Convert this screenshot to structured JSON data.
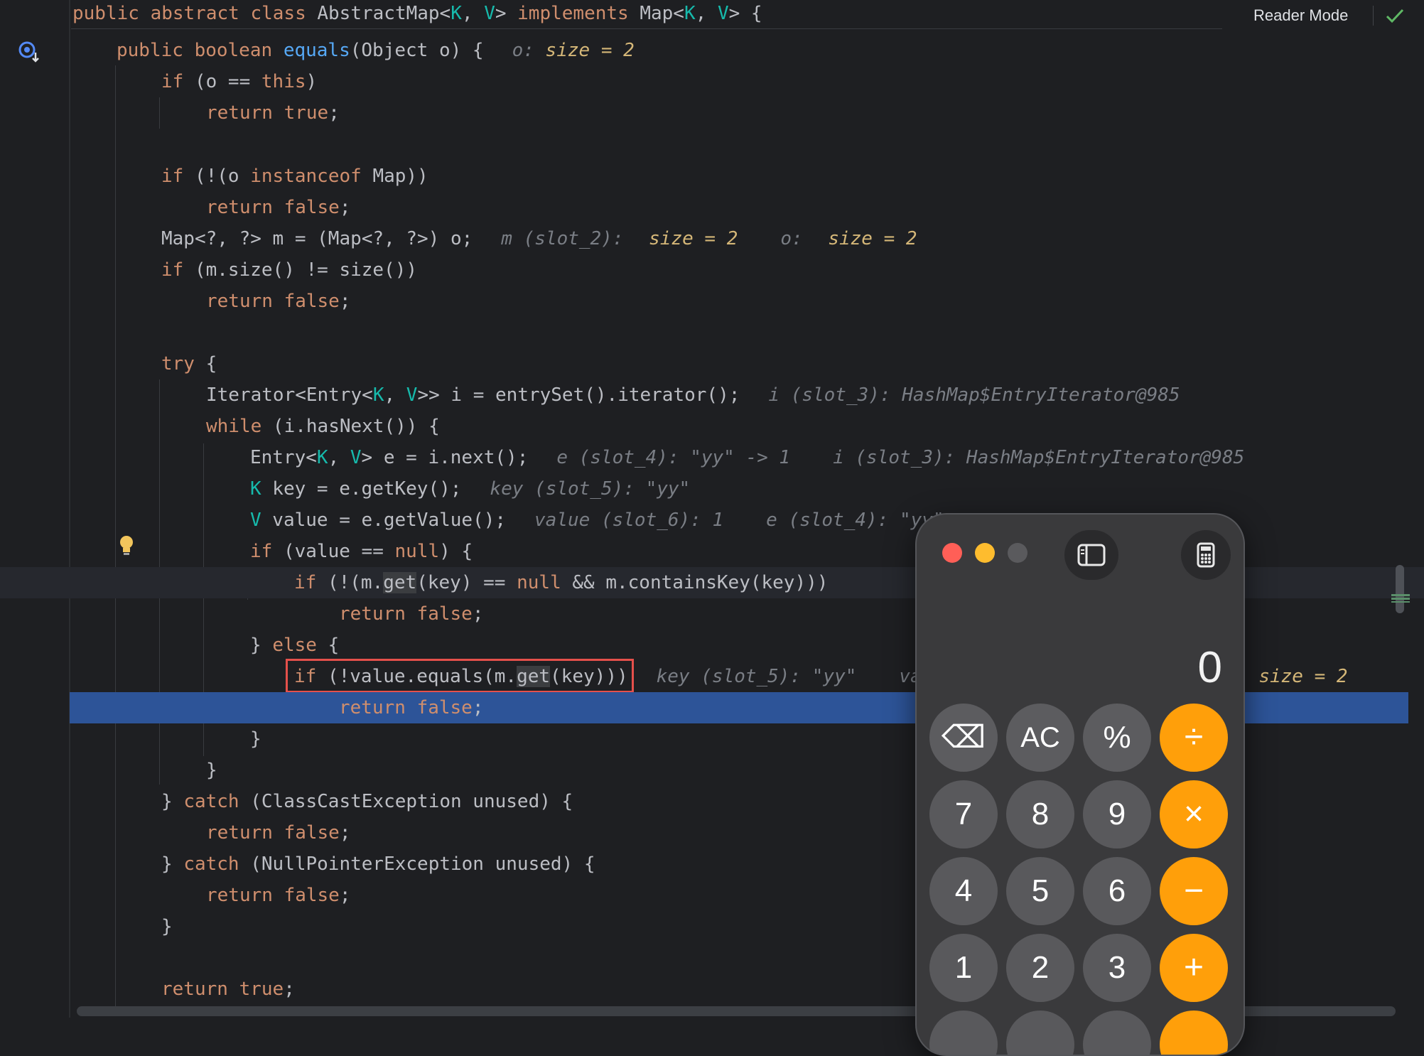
{
  "header": {
    "class_decl": {
      "kw1": "public abstract class ",
      "name": "AbstractMap<",
      "k": "K",
      "comma": ", ",
      "v": "V",
      "close": "> ",
      "kw2": "implements ",
      "iface": "Map<",
      "k2": "K",
      "comma2": ", ",
      "v2": "V",
      "tail": "> {"
    },
    "reader_mode_label": "Reader Mode"
  },
  "code": {
    "l1": {
      "a": "public boolean ",
      "fn": "equals",
      "b": "(Object o) {",
      "h1": "o: ",
      "v1": "size = 2"
    },
    "l2": {
      "kw": "if ",
      "a": "(o == ",
      "kw2": "this",
      "b": ")"
    },
    "l3": {
      "kw": "return true",
      "b": ";"
    },
    "l5": {
      "kw": "if ",
      "a": "(!(o ",
      "kw2": "instanceof ",
      "b": "Map))"
    },
    "l6": {
      "kw": "return false",
      "b": ";"
    },
    "l7": {
      "a": "Map<?, ?> m = (Map<?, ?>) o;",
      "h1": "m (slot_2): ",
      "v1": "size = 2",
      "h2": "o: ",
      "v2": "size = 2"
    },
    "l8": {
      "kw": "if ",
      "a": "(m.size() != size())"
    },
    "l9": {
      "kw": "return false",
      "b": ";"
    },
    "l11": {
      "kw": "try ",
      "a": "{"
    },
    "l12": {
      "a": "Iterator<Entry<",
      "k": "K",
      "c": ", ",
      "v": "V",
      "b": ">> i = entrySet().iterator();",
      "h1": "i (slot_3): HashMap$EntryIterator@985"
    },
    "l13": {
      "kw": "while ",
      "a": "(i.hasNext()) {"
    },
    "l14": {
      "a": "Entry<",
      "k": "K",
      "c": ", ",
      "v": "V",
      "b": "> e = i.next();",
      "h1": "e (slot_4): \"yy\" -> 1",
      "h2": "i (slot_3): HashMap$EntryIterator@985"
    },
    "l15": {
      "k": "K",
      "a": " key = e.getKey();",
      "h1": "key (slot_5): \"yy\""
    },
    "l16": {
      "v": "V",
      "a": " value = e.getValue();",
      "h1": "value (slot_6): 1",
      "h2": "e (slot_4): \"yy\""
    },
    "l17": {
      "kw": "if ",
      "a": "(value == ",
      "kw2": "null",
      "b": ") {"
    },
    "l18": {
      "kw": "if ",
      "a": "(!(m.",
      "get": "get",
      "b": "(key) == ",
      "kw2": "null",
      "c": " && m.containsKey(key)))"
    },
    "l19": {
      "kw": "return false",
      "b": ";"
    },
    "l20": {
      "a": "} ",
      "kw": "else ",
      "b": "{"
    },
    "l21": {
      "kw": "if ",
      "a": "(!value.equals(m.",
      "get": "get",
      "b": "(key)))",
      "h1": "key (slot_5): \"yy\"",
      "h2": "va",
      "h3": ": ",
      "v3": "size = 2"
    },
    "l22": {
      "kw": "return false",
      "b": ";"
    },
    "l23": {
      "a": "}"
    },
    "l24": {
      "a": "}"
    },
    "l25": {
      "a": "} ",
      "kw": "catch ",
      "b": "(ClassCastException unused) {"
    },
    "l26": {
      "kw": "return false",
      "b": ";"
    },
    "l27": {
      "a": "} ",
      "kw": "catch ",
      "b": "(NullPointerException unused) {"
    },
    "l28": {
      "kw": "return false",
      "b": ";"
    },
    "l29": {
      "a": "}"
    },
    "l31": {
      "kw": "return true",
      "b": ";"
    }
  },
  "calculator": {
    "display": "0",
    "keys": {
      "backspace": "⌫",
      "ac": "AC",
      "percent": "%",
      "divide": "÷",
      "seven": "7",
      "eight": "8",
      "nine": "9",
      "multiply": "×",
      "four": "4",
      "five": "5",
      "six": "6",
      "minus": "−",
      "one": "1",
      "two": "2",
      "three": "3",
      "plus": "+"
    }
  },
  "colors": {
    "keyword": "#cf8e6d",
    "function": "#56a8f5",
    "type_param": "#16baac",
    "hint": "#7a7e85",
    "hint_value": "#d5b778",
    "exec_line": "#2d5498",
    "red_box": "#e5504b",
    "calc_operator": "#ff9f0a"
  },
  "icons": {
    "debug": "debug-step-icon",
    "bulb": "lightbulb-icon",
    "check": "check-icon",
    "sidebar": "sidebar-toggle-icon",
    "calc": "calculator-icon"
  }
}
